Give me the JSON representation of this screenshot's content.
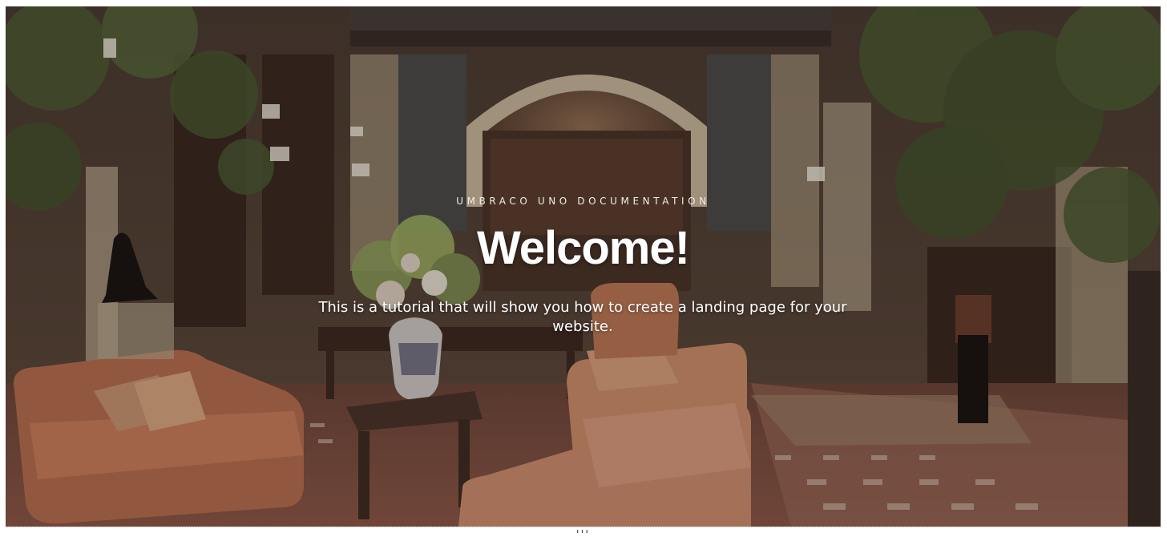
{
  "hero": {
    "eyebrow": "UMBRACO UNO DOCUMENTATION",
    "title": "Welcome!",
    "subtitle": "This is a tutorial that will show you how to create a landing page for your website."
  },
  "bottom_bar": {
    "handle": "┃┃┃"
  },
  "colors": {
    "overlay": "#000000",
    "text": "#ffffff",
    "background_tone": "#3a2a22"
  }
}
